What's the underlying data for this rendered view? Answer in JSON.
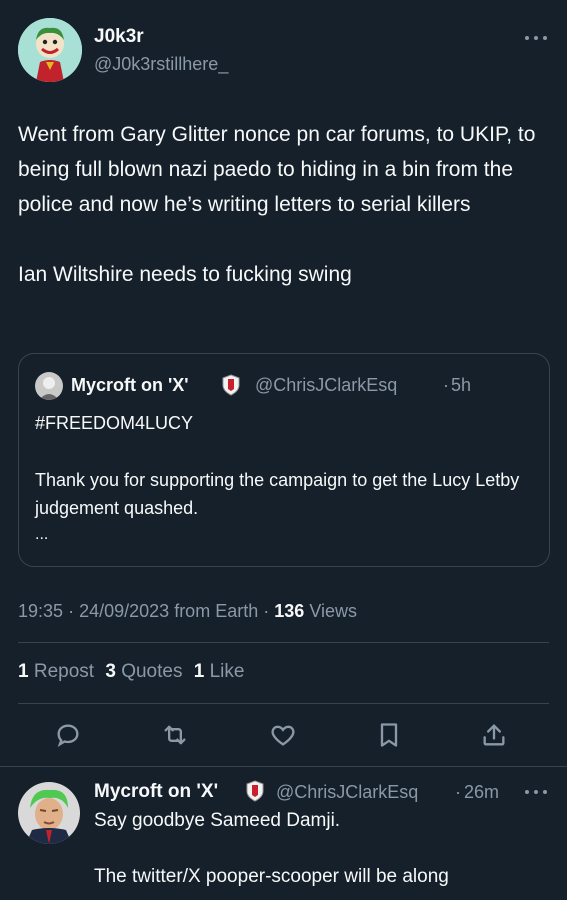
{
  "tweet": {
    "author_name": "J0k3r",
    "author_handle": "@J0k3rstillhere_",
    "more_icon": "more-dots-icon",
    "text": "Went from Gary Glitter nonce pn car forums, to UKIP, to being full blown nazi paedo to hiding in a bin from the police and now he’s writing letters to serial killers\n\nIan Wiltshire needs to fucking swing",
    "quoted": {
      "author_name": "Mycroft on 'X'",
      "handle": "@ChrisJClarkEsq",
      "sep": "·",
      "time": "5h",
      "line1": "#FREEDOM4LUCY",
      "line2": "Thank you for supporting the campaign to get the Lucy Letby judgement quashed.",
      "ellipsis": "..."
    },
    "meta": {
      "time": "19:35",
      "sep1": "·",
      "date": "24/09/2023",
      "from": "from Earth",
      "sep2": "·",
      "views_count": "136",
      "views_label": "Views"
    },
    "stats": {
      "reposts_count": "1",
      "reposts_label": "Repost",
      "quotes_count": "3",
      "quotes_label": "Quotes",
      "likes_count": "1",
      "likes_label": "Like"
    },
    "actions": [
      "reply-icon",
      "retweet-icon",
      "like-icon",
      "bookmark-icon",
      "share-icon"
    ]
  },
  "reply": {
    "author_name": "Mycroft on 'X'",
    "handle": "@ChrisJClarkEsq",
    "sep": "·",
    "time": "26m",
    "line1": "Say goodbye Sameed Damji.",
    "line2": "The twitter/X pooper-scooper will be along"
  },
  "colors": {
    "background": "#15202b",
    "text": "#f7f9f9",
    "muted": "#8b98a5",
    "border": "#38444d"
  }
}
